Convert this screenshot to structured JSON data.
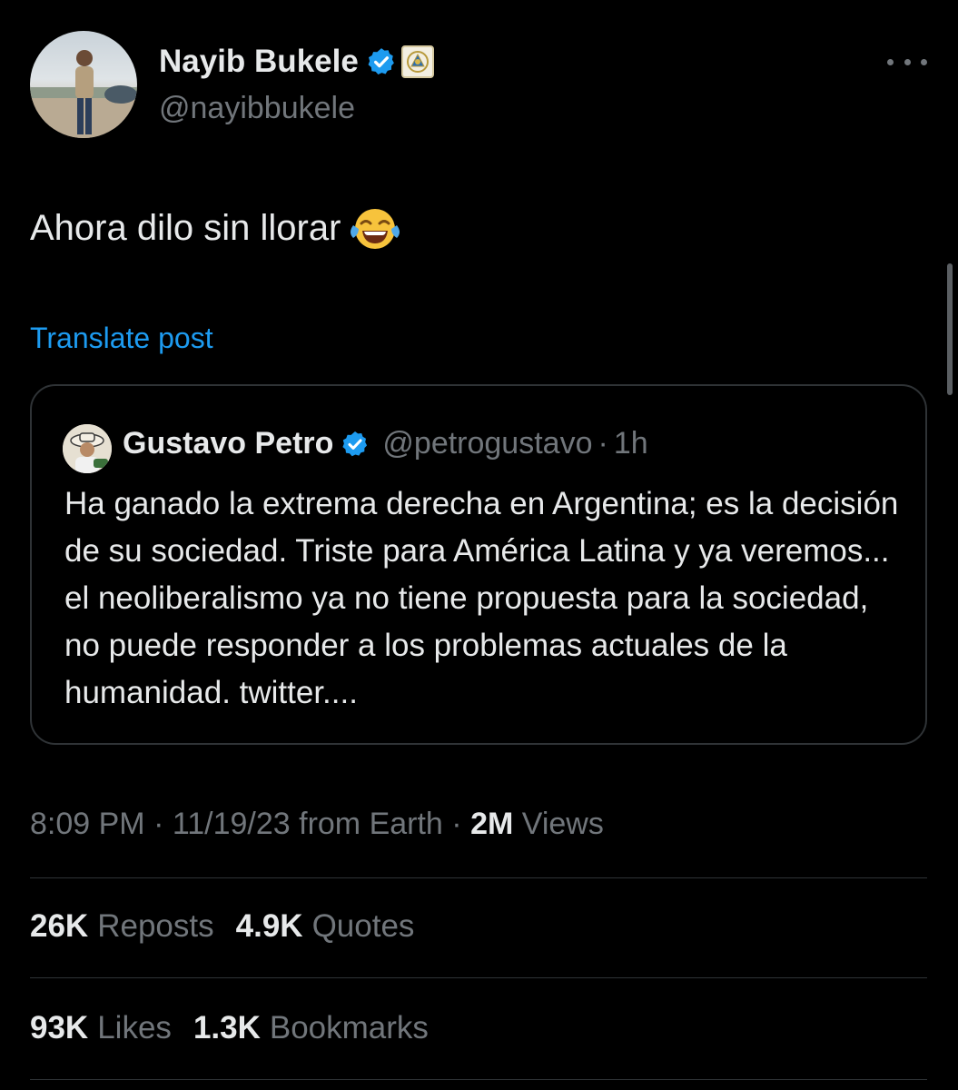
{
  "author": {
    "name": "Nayib Bukele",
    "handle": "@nayibbukele"
  },
  "post": {
    "text": "Ahora dilo sin llorar",
    "emoji": "face-with-tears-of-joy",
    "translate_label": "Translate post"
  },
  "quoted": {
    "name": "Gustavo Petro",
    "handle": "@petrogustavo",
    "separator": "·",
    "time": "1h",
    "text": "Ha ganado la extrema derecha en Argentina; es la decisión de su sociedad. Triste para América Latina y ya veremos... el neoliberalismo ya no tiene propuesta para la sociedad, no puede responder a los problemas actuales de la humanidad. twitter...."
  },
  "meta": {
    "time": "8:09 PM",
    "sep1": "·",
    "date": "11/19/23 from Earth",
    "sep2": "·",
    "views_value": "2M",
    "views_label": "Views"
  },
  "stats": {
    "reposts_value": "26K",
    "reposts_label": "Reposts",
    "quotes_value": "4.9K",
    "quotes_label": "Quotes",
    "likes_value": "93K",
    "likes_label": "Likes",
    "bookmarks_value": "1.3K",
    "bookmarks_label": "Bookmarks"
  },
  "colors": {
    "background": "#000000",
    "text_primary": "#e7e9ea",
    "text_secondary": "#71767b",
    "link": "#1d9bf0",
    "verified": "#1d9bf0",
    "border": "#2f3336"
  }
}
